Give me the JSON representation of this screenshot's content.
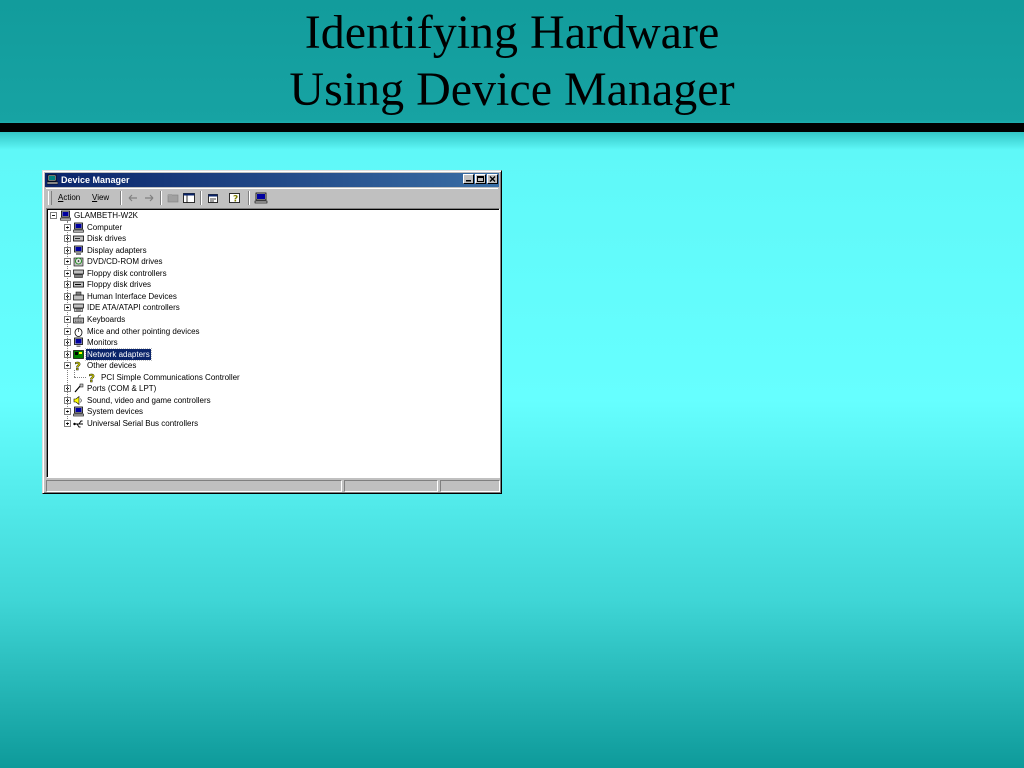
{
  "slide": {
    "title_line1": "Identifying Hardware",
    "title_line2": "Using Device Manager"
  },
  "window": {
    "title": "Device Manager",
    "icon": "computer-icon",
    "controls": [
      "minimize-icon",
      "maximize-icon",
      "close-icon"
    ]
  },
  "toolbar": {
    "menus": [
      {
        "label": "Action",
        "accel": "A"
      },
      {
        "label": "View",
        "accel": "V"
      }
    ],
    "buttons": [
      "back-arrow-icon",
      "forward-arrow-icon",
      "folder-up-icon",
      "show-hide-tree-icon",
      "properties-icon",
      "help-icon",
      "computer-scan-icon"
    ]
  },
  "tree": {
    "root": {
      "label": "GLAMBETH-W2K",
      "icon": "computer-icon",
      "expanded": true
    },
    "items": [
      {
        "label": "Computer",
        "icon": "computer-icon",
        "expanded": false
      },
      {
        "label": "Disk drives",
        "icon": "disk-drive-icon",
        "expanded": false
      },
      {
        "label": "Display adapters",
        "icon": "display-adapter-icon",
        "expanded": false
      },
      {
        "label": "DVD/CD-ROM drives",
        "icon": "cdrom-icon",
        "expanded": false
      },
      {
        "label": "Floppy disk controllers",
        "icon": "floppy-controller-icon",
        "expanded": false
      },
      {
        "label": "Floppy disk drives",
        "icon": "floppy-drive-icon",
        "expanded": false
      },
      {
        "label": "Human Interface Devices",
        "icon": "hid-icon",
        "expanded": false
      },
      {
        "label": "IDE ATA/ATAPI controllers",
        "icon": "ide-controller-icon",
        "expanded": false
      },
      {
        "label": "Keyboards",
        "icon": "keyboard-icon",
        "expanded": false
      },
      {
        "label": "Mice and other pointing devices",
        "icon": "mouse-icon",
        "expanded": false
      },
      {
        "label": "Monitors",
        "icon": "monitor-icon",
        "expanded": false
      },
      {
        "label": "Network adapters",
        "icon": "network-adapter-icon",
        "expanded": false,
        "selected": true
      },
      {
        "label": "Other devices",
        "icon": "question-mark-icon",
        "expanded": true,
        "children": [
          {
            "label": "PCI Simple Communications Controller",
            "icon": "question-mark-icon"
          }
        ]
      },
      {
        "label": "Ports (COM & LPT)",
        "icon": "port-icon",
        "expanded": false
      },
      {
        "label": "Sound, video and game controllers",
        "icon": "speaker-icon",
        "expanded": false
      },
      {
        "label": "System devices",
        "icon": "system-device-icon",
        "expanded": false
      },
      {
        "label": "Universal Serial Bus controllers",
        "icon": "usb-icon",
        "expanded": false
      }
    ]
  },
  "colors": {
    "titlebar_start": "#0a246a",
    "titlebar_end": "#3a6ea5",
    "selection": "#0a246a",
    "window_face": "#c0c0c0",
    "slide_bg": "#66ffff"
  }
}
